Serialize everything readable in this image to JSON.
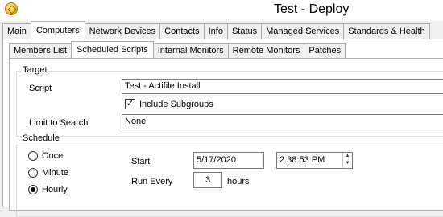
{
  "window": {
    "title": "Test - Deploy",
    "icon": "app-icon"
  },
  "main_tabs": [
    {
      "label": "Main",
      "active": false
    },
    {
      "label": "Computers",
      "active": true
    },
    {
      "label": "Network Devices",
      "active": false
    },
    {
      "label": "Contacts",
      "active": false
    },
    {
      "label": "Info",
      "active": false
    },
    {
      "label": "Status",
      "active": false
    },
    {
      "label": "Managed Services",
      "active": false
    },
    {
      "label": "Standards & Health",
      "active": false
    }
  ],
  "sub_tabs": [
    {
      "label": "Members List",
      "active": false
    },
    {
      "label": "Scheduled Scripts",
      "active": true
    },
    {
      "label": "Internal Monitors",
      "active": false
    },
    {
      "label": "Remote Monitors",
      "active": false
    },
    {
      "label": "Patches",
      "active": false
    }
  ],
  "target": {
    "group_label": "Target",
    "script_label": "Script",
    "script_value": "Test - Actifile Install",
    "include_subgroups_label": "Include Subgroups",
    "include_subgroups_checked": true,
    "limit_label": "Limit to Search",
    "limit_value": "None"
  },
  "schedule": {
    "group_label": "Schedule",
    "options": [
      {
        "label": "Once",
        "checked": false
      },
      {
        "label": "Minute",
        "checked": false
      },
      {
        "label": "Hourly",
        "checked": true
      }
    ],
    "start_label": "Start",
    "start_date": "5/17/2020",
    "start_time": "2:38:53 PM",
    "run_every_label": "Run Every",
    "run_every_value": "3",
    "run_every_unit": "hours"
  }
}
